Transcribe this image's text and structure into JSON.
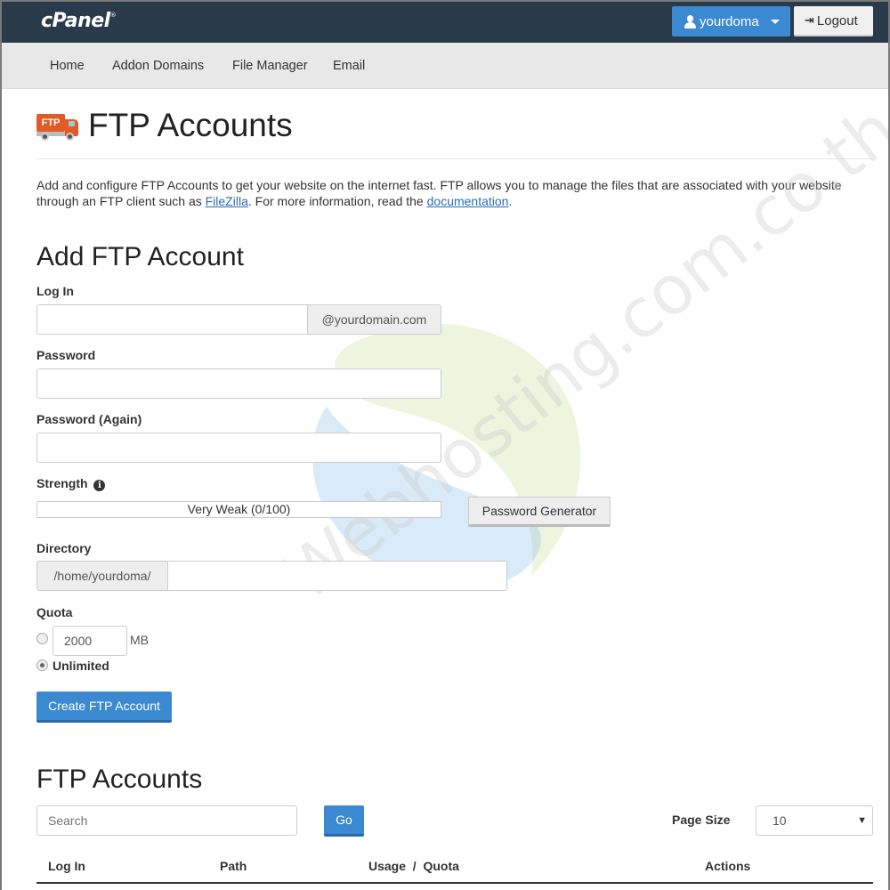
{
  "topbar": {
    "logo": "cPanel",
    "logo_mark": "®",
    "user_label": "yourdoma",
    "logout_label": "Logout"
  },
  "nav": {
    "items": [
      {
        "label": "Home"
      },
      {
        "label": "Addon Domains"
      },
      {
        "label": "File Manager"
      },
      {
        "label": "Email"
      }
    ]
  },
  "page": {
    "icon_text": "FTP",
    "title": "FTP Accounts",
    "description_part1": "Add and configure FTP Accounts to get your website on the internet fast. FTP allows you to manage the files that are associated with your website through an FTP client such as ",
    "filezilla_link": "FileZilla",
    "description_part2": ". For more information, read the ",
    "documentation_link": "documentation",
    "description_part3": "."
  },
  "add_form": {
    "heading": "Add FTP Account",
    "login_label": "Log In",
    "login_value": "",
    "domain_suffix": "@yourdomain.com",
    "password_label": "Password",
    "password_value": "",
    "password_again_label": "Password (Again)",
    "password_again_value": "",
    "strength_label": "Strength",
    "strength_text": "Very Weak (0/100)",
    "strength_value": 0,
    "password_generator_label": "Password Generator",
    "directory_label": "Directory",
    "directory_prefix": "/home/yourdoma/",
    "directory_value": "",
    "quota_label": "Quota",
    "quota_value": "2000",
    "quota_unit": "MB",
    "unlimited_label": "Unlimited",
    "quota_selected": "unlimited",
    "create_button": "Create FTP Account"
  },
  "accounts": {
    "heading": "FTP Accounts",
    "search_placeholder": "Search",
    "go_label": "Go",
    "page_size_label": "Page Size",
    "page_size_value": "10",
    "columns": [
      "Log In",
      "Path",
      "Usage  /  Quota",
      "Actions"
    ]
  },
  "watermark": "Webhosting.com.co.th",
  "colors": {
    "topbar": "#293a4a",
    "primary": "#3b8ad1",
    "link": "#2a6db5"
  }
}
